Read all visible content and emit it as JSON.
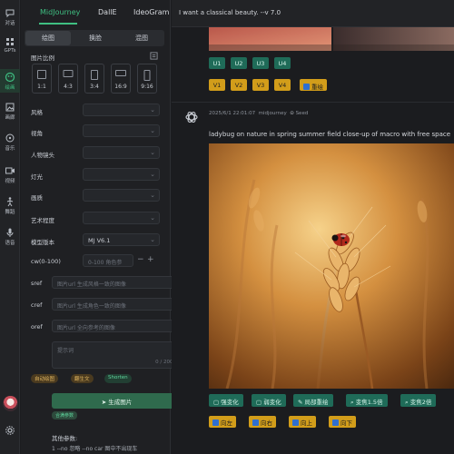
{
  "rail": {
    "items": [
      {
        "label": "对话",
        "icon": "chat-icon"
      },
      {
        "label": "GPTs",
        "icon": "gpts-icon"
      },
      {
        "label": "绘画",
        "icon": "palette-icon",
        "active": true
      },
      {
        "label": "画廊",
        "icon": "gallery-icon"
      },
      {
        "label": "音乐",
        "icon": "music-icon"
      },
      {
        "label": "视频",
        "icon": "video-icon"
      },
      {
        "label": "舞蹈",
        "icon": "dance-icon"
      },
      {
        "label": "语音",
        "icon": "mic-icon"
      }
    ],
    "settings_icon": "gear-icon"
  },
  "panel": {
    "tabs": [
      "MidJourney",
      "DallE",
      "IdeoGram"
    ],
    "subtabs": [
      "绘图",
      "换脸",
      "混图"
    ],
    "ratio_label": "图片比例",
    "ratios": [
      "1:1",
      "4:3",
      "3:4",
      "16:9",
      "9:16"
    ],
    "fields": [
      {
        "label": "风格",
        "value": ""
      },
      {
        "label": "视角",
        "value": ""
      },
      {
        "label": "人物镜头",
        "value": ""
      },
      {
        "label": "灯光",
        "value": ""
      },
      {
        "label": "画质",
        "value": ""
      },
      {
        "label": "艺术程度",
        "value": ""
      },
      {
        "label": "模型版本",
        "value": "MJ V6.1"
      }
    ],
    "cw_label": "cw(0-100)",
    "cw_placeholder": "0-100 角色参",
    "refs": [
      {
        "label": "sref",
        "placeholder": "图片url 生成风格一致的图像"
      },
      {
        "label": "cref",
        "placeholder": "图片url 生成角色一致的图像"
      },
      {
        "label": "oref",
        "placeholder": "图片url 全向参考的图像"
      }
    ],
    "prompt_placeholder": "提示词",
    "prompt_count": "0 / 2000",
    "chips": [
      "自动绘图",
      "翻生文",
      "Shorten"
    ],
    "generate_label": "生成图片",
    "small_chip": "合满参数",
    "other_params_label": "其他参数:",
    "other_params_text": "1 --no 忽略 --no car 图中不出现车"
  },
  "main": {
    "prompt_text": "I want a classical beauty. --v 7.0",
    "upscale_buttons": [
      "U1",
      "U2",
      "U3",
      "U4"
    ],
    "variation_buttons": [
      "V1",
      "V2",
      "V3",
      "V4"
    ],
    "reroll_label": "重绘",
    "meta_date": "2025/6/1 22:01:07",
    "meta_model": "midjourney",
    "meta_seed": "Seed",
    "description": "ladybug on nature in spring summer field close-up of macro with free space",
    "actions_green": [
      "强变化",
      "弱变化",
      "局部重绘",
      "变焦1.5倍",
      "变焦2倍"
    ],
    "actions_pan": [
      "向左",
      "向右",
      "向上",
      "向下"
    ]
  },
  "colors": {
    "accent": "#3fbf82",
    "u_button": "#1f6b58",
    "v_button": "#d29d1a"
  }
}
